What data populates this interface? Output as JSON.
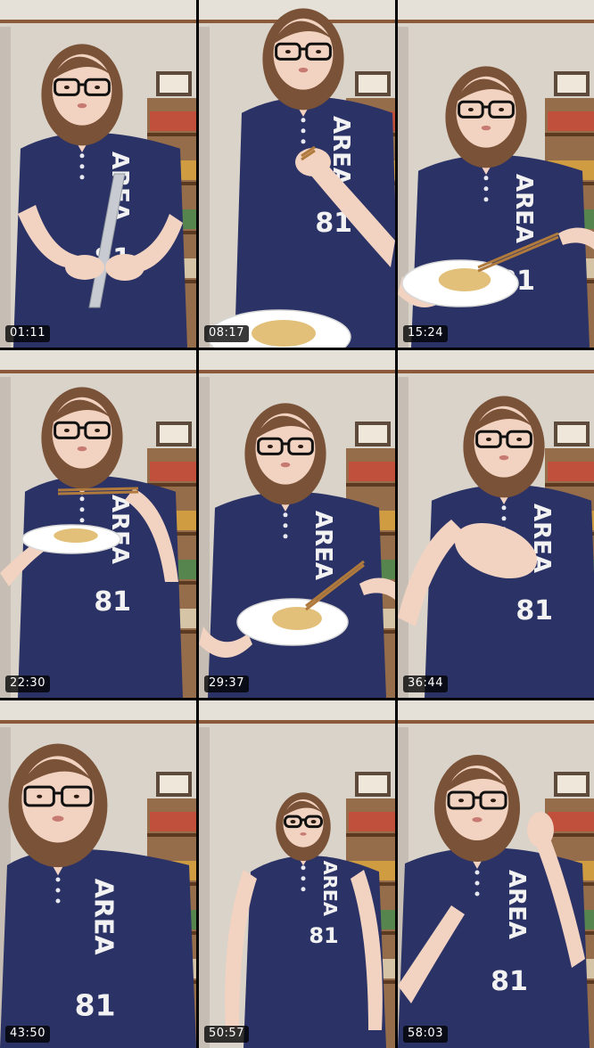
{
  "grid": {
    "columns": 3,
    "rows": 3,
    "background": "#000000"
  },
  "frames": [
    {
      "timestamp": "01:11",
      "activity": "cutting",
      "shirt_text": "AREA",
      "shirt_number": "81"
    },
    {
      "timestamp": "08:17",
      "activity": "eating",
      "shirt_text": "AREA",
      "shirt_number": "81"
    },
    {
      "timestamp": "15:24",
      "activity": "holding-plate",
      "shirt_text": "AREA",
      "shirt_number": "81"
    },
    {
      "timestamp": "22:30",
      "activity": "eating",
      "shirt_text": "AREA",
      "shirt_number": "81"
    },
    {
      "timestamp": "29:37",
      "activity": "holding-plate",
      "shirt_text": "AREA",
      "shirt_number": "81"
    },
    {
      "timestamp": "36:44",
      "activity": "gesturing",
      "shirt_text": "AREA",
      "shirt_number": "81"
    },
    {
      "timestamp": "43:50",
      "activity": "talking",
      "shirt_text": "AREA",
      "shirt_number": "81"
    },
    {
      "timestamp": "50:57",
      "activity": "standing",
      "shirt_text": "AREA",
      "shirt_number": "81"
    },
    {
      "timestamp": "58:03",
      "activity": "touching-hair",
      "shirt_text": "AREA",
      "shirt_number": "81"
    }
  ],
  "colors": {
    "wall": "#d9d3c9",
    "wall_shadow": "#b9b1a6",
    "ceiling_trim": "#8a5a3a",
    "shelf": "#8a5a34",
    "shirt": "#2b3266",
    "shirt_dark": "#1f2550",
    "skin": "#f2d2c0",
    "hair": "#7a5238",
    "glasses": "#111111",
    "plate": "#ffffff",
    "noodles": "#e3c07a",
    "chopsticks": "#b07a3d",
    "timestamp_bg": "#000000",
    "timestamp_text": "#ffffff"
  }
}
